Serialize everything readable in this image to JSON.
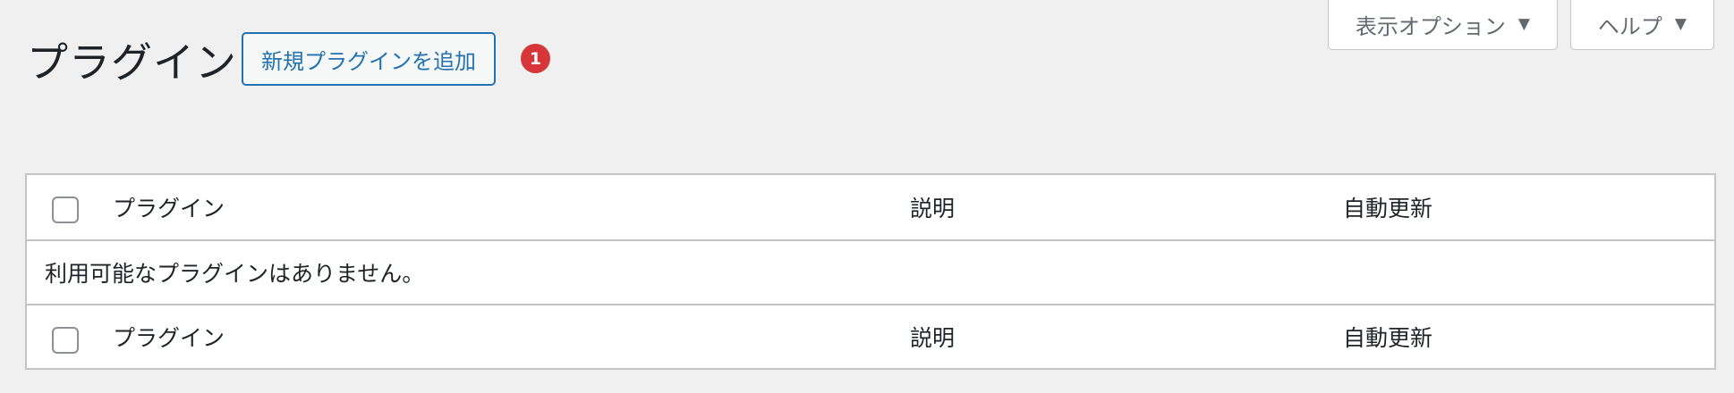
{
  "screen_meta": {
    "options_label": "表示オプション",
    "help_label": "ヘルプ"
  },
  "page_title": "プラグイン",
  "add_new_label": "新規プラグインを追加",
  "update_count": "1",
  "table": {
    "columns": {
      "name": "プラグイン",
      "description": "説明",
      "auto_update": "自動更新"
    },
    "empty_message": "利用可能なプラグインはありません。"
  }
}
